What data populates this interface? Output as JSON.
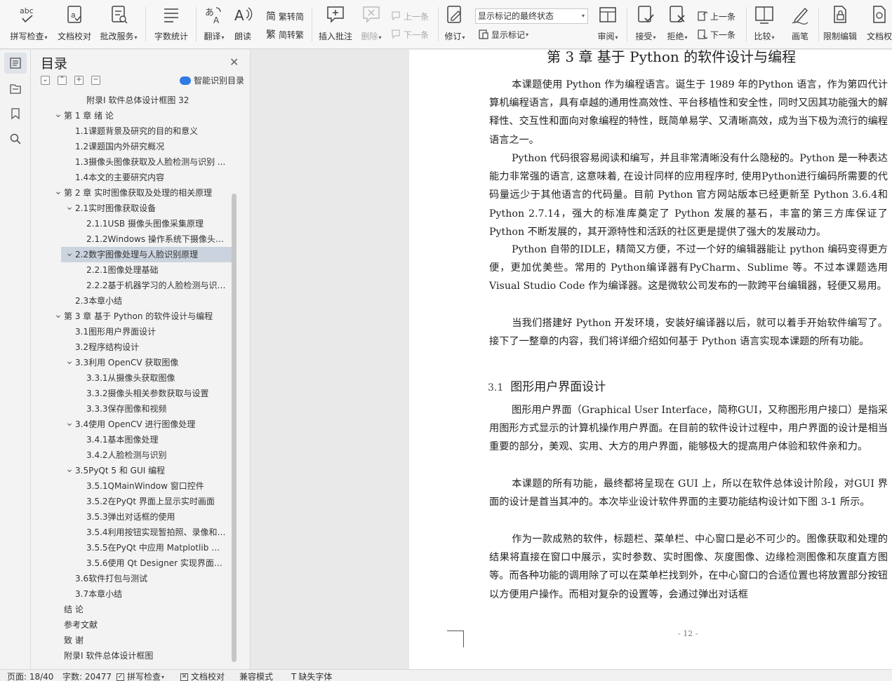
{
  "ribbon": {
    "spell_check": "拼写检查",
    "doc_proof": "文档校对",
    "correction_service": "批改服务",
    "word_count": "字数统计",
    "translate": "翻译",
    "read_aloud": "朗读",
    "to_traditional": "繁转简",
    "to_simplified": "简转繁",
    "insert_comment": "插入批注",
    "delete": "删除",
    "prev_comment": "上一条",
    "next_comment": "下一条",
    "track_changes": "修订",
    "markup_state": "显示标记的最终状态",
    "show_markup": "显示标记",
    "review": "审阅",
    "accept": "接受",
    "reject": "拒绝",
    "prev_change": "上一条",
    "next_change": "下一条",
    "compare": "比较",
    "ink": "画笔",
    "restrict_edit": "限制编辑",
    "doc_permission": "文档权"
  },
  "toc": {
    "title": "目录",
    "smart_toc": "智能识别目录",
    "items": [
      {
        "text": "附录I 软件总体设计框图 32",
        "level": 4,
        "chev": ""
      },
      {
        "text": "第 1 章 绪 论",
        "level": 1,
        "chev": "v"
      },
      {
        "text": "1.1课题背景及研究的目的和意义",
        "level": 2,
        "chev": ""
      },
      {
        "text": "1.2课题国内外研究概况",
        "level": 2,
        "chev": ""
      },
      {
        "text": "1.3摄像头图像获取及人脸检测与识别 ...",
        "level": 2,
        "chev": ""
      },
      {
        "text": "1.4本文的主要研究内容",
        "level": 2,
        "chev": ""
      },
      {
        "text": "第 2 章 实时图像获取及处理的相关原理",
        "level": 1,
        "chev": "v"
      },
      {
        "text": "2.1实时图像获取设备",
        "level": 2,
        "chev": "v"
      },
      {
        "text": "2.1.1USB 摄像头图像采集原理",
        "level": 3,
        "chev": ""
      },
      {
        "text": "2.1.2Windows 操作系统下摄像头 ...",
        "level": 3,
        "chev": ""
      },
      {
        "text": "2.2数字图像处理与人脸识别原理",
        "level": 2,
        "chev": "v",
        "selected": true
      },
      {
        "text": "2.2.1图像处理基础",
        "level": 3,
        "chev": ""
      },
      {
        "text": "2.2.2基于机器学习的人脸检测与识 ...",
        "level": 3,
        "chev": ""
      },
      {
        "text": "2.3本章小结",
        "level": 2,
        "chev": ""
      },
      {
        "text": "第 3 章 基于 Python 的软件设计与编程",
        "level": 1,
        "chev": "v"
      },
      {
        "text": "3.1图形用户界面设计",
        "level": 2,
        "chev": ""
      },
      {
        "text": "3.2程序结构设计",
        "level": 2,
        "chev": ""
      },
      {
        "text": "3.3利用 OpenCV 获取图像",
        "level": 2,
        "chev": "v"
      },
      {
        "text": "3.3.1从摄像头获取图像",
        "level": 3,
        "chev": ""
      },
      {
        "text": "3.3.2摄像头相关参数获取与设置",
        "level": 3,
        "chev": ""
      },
      {
        "text": "3.3.3保存图像和视频",
        "level": 3,
        "chev": ""
      },
      {
        "text": "3.4使用 OpenCV 进行图像处理",
        "level": 2,
        "chev": "v"
      },
      {
        "text": "3.4.1基本图像处理",
        "level": 3,
        "chev": ""
      },
      {
        "text": "3.4.2人脸检测与识别",
        "level": 3,
        "chev": ""
      },
      {
        "text": "3.5PyQt 5 和 GUI 编程",
        "level": 2,
        "chev": "v"
      },
      {
        "text": "3.5.1QMainWindow 窗口控件",
        "level": 3,
        "chev": ""
      },
      {
        "text": "3.5.2在PyQt 界面上显示实时画面",
        "level": 3,
        "chev": ""
      },
      {
        "text": "3.5.3弹出对话框的使用",
        "level": 3,
        "chev": ""
      },
      {
        "text": "3.5.4利用按钮实现暂拍照、录像和 ...",
        "level": 3,
        "chev": ""
      },
      {
        "text": "3.5.5在PyQt 中应用 Matplotlib 绘 ...",
        "level": 3,
        "chev": ""
      },
      {
        "text": "3.5.6使用 Qt Designer 实现界面显 ...",
        "level": 3,
        "chev": ""
      },
      {
        "text": "3.6软件打包与测试",
        "level": 2,
        "chev": ""
      },
      {
        "text": "3.7本章小结",
        "level": 2,
        "chev": ""
      },
      {
        "text": "结 论",
        "level": 1,
        "chev": ""
      },
      {
        "text": "参考文献",
        "level": 1,
        "chev": ""
      },
      {
        "text": "致 谢",
        "level": 1,
        "chev": ""
      },
      {
        "text": "附录I 软件总体设计框图",
        "level": 1,
        "chev": ""
      }
    ]
  },
  "document": {
    "chapter_title": "第 3 章 基于 Python 的软件设计与编程",
    "paragraphs": [
      "本课题使用 Python 作为编程语言。诞生于 1989 年的Python 语言，作为第四代计算机编程语言，具有卓越的通用性高效性、平台移植性和安全性，同时又因其功能强大的解释性、交互性和面向对象编程的特性，既简单易学、又清晰高效，成为当下极为流行的编程语言之一。",
      "Python 代码很容易阅读和编写，并且非常清晰没有什么隐秘的。Python 是一种表达能力非常强的语言, 这意味着, 在设计同样的应用程序时, 使用Python进行编码所需要的代码量远少于其他语言的代码量。目前 Python 官方网站版本已经更新至 Python 3.6.4和Python 2.7.14，强大的标准库奠定了 Python 发展的基石，丰富的第三方库保证了 Python 不断发展的，其开源特性和活跃的社区更是提供了强大的发展动力。",
      "Python 自带的IDLE，精简又方便，不过一个好的编辑器能让 python 编码变得更方便，更加优美些。常用的 Python编译器有PyCharm、Sublime 等。不过本课题选用Visual Studio Code 作为编译器。这是微软公司发布的一款跨平台编辑器，轻便又易用。",
      "当我们搭建好 Python 开发环境，安装好编译器以后，就可以着手开始软件编写了。接下了一整章的内容，我们将详细介绍如何基于 Python 语言实现本课题的所有功能。"
    ],
    "section_number": "3.1",
    "section_title": "图形用户界面设计",
    "section_paragraphs": [
      "图形用户界面（Graphical User Interface，简称GUI，又称图形用户接口）是指采用图形方式显示的计算机操作用户界面。在目前的软件设计过程中，用户界面的设计是相当重要的部分，美观、实用、大方的用户界面，能够极大的提高用户体验和软件亲和力。",
      "本课题的所有功能，最终都将呈现在 GUI 上，所以在软件总体设计阶段，对GUI 界面的设计是首当其冲的。本次毕业设计软件界面的主要功能结构设计如下图 3-1 所示。",
      "作为一款成熟的软件，标题栏、菜单栏、中心窗口是必不可少的。图像获取和处理的结果将直接在窗口中展示，实时参数、实时图像、灰度图像、边缘检测图像和灰度直方图等。而各种功能的调用除了可以在菜单栏找到外，在中心窗口的合适位置也将放置部分按钮以方便用户操作。而相对复杂的设置等，会通过弹出对话框"
    ],
    "page_number": "- 12 -"
  },
  "status": {
    "page": "页面: 18/40",
    "words": "字数: 20477",
    "spell_check": "拼写检查",
    "doc_proof": "文档校对",
    "compat": "兼容模式",
    "missing_font": "缺失字体"
  }
}
